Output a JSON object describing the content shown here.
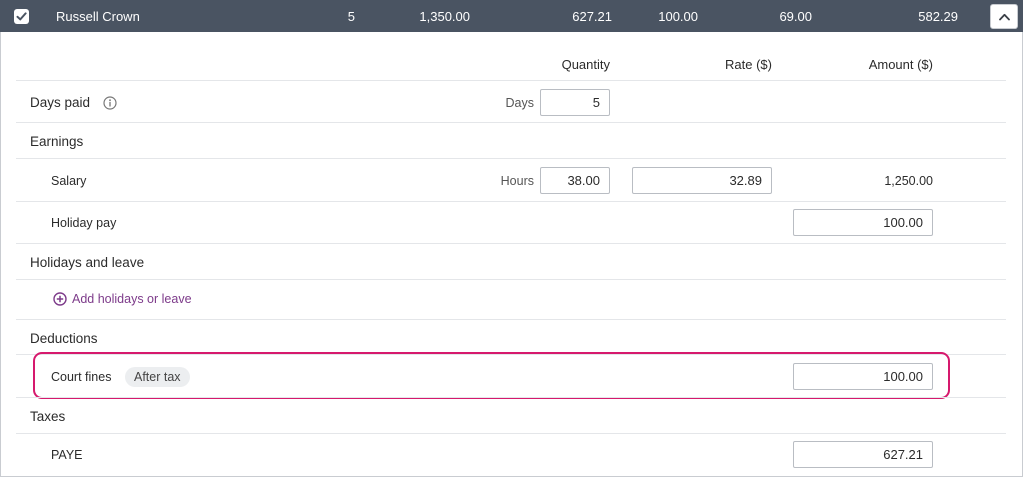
{
  "header": {
    "employee_name": "Russell Crown",
    "days": "5",
    "gross": "1,350.00",
    "tax": "627.21",
    "deductions": "100.00",
    "super": "69.00",
    "net_pay": "582.29"
  },
  "columns": {
    "quantity": "Quantity",
    "rate": "Rate ($)",
    "amount": "Amount ($)"
  },
  "days_paid": {
    "label": "Days paid",
    "unit": "Days",
    "value": "5"
  },
  "earnings": {
    "label": "Earnings",
    "salary": {
      "label": "Salary",
      "unit": "Hours",
      "quantity": "38.00",
      "rate": "32.89",
      "amount": "1,250.00"
    },
    "holiday_pay": {
      "label": "Holiday pay",
      "amount": "100.00"
    }
  },
  "holidays_leave": {
    "label": "Holidays and leave",
    "add_link": "Add holidays or leave"
  },
  "deductions": {
    "label": "Deductions",
    "court_fines": {
      "label": "Court fines",
      "badge": "After tax",
      "amount": "100.00"
    }
  },
  "taxes": {
    "label": "Taxes",
    "paye": {
      "label": "PAYE",
      "amount": "627.21"
    }
  },
  "colors": {
    "header_bg": "#4a5462",
    "link": "#7d3b8a",
    "highlight": "#d6196d"
  },
  "icons": {
    "select": "checkbox-checked-icon",
    "collapse": "chevron-up-icon",
    "info": "info-icon",
    "add": "plus-circle-icon"
  }
}
